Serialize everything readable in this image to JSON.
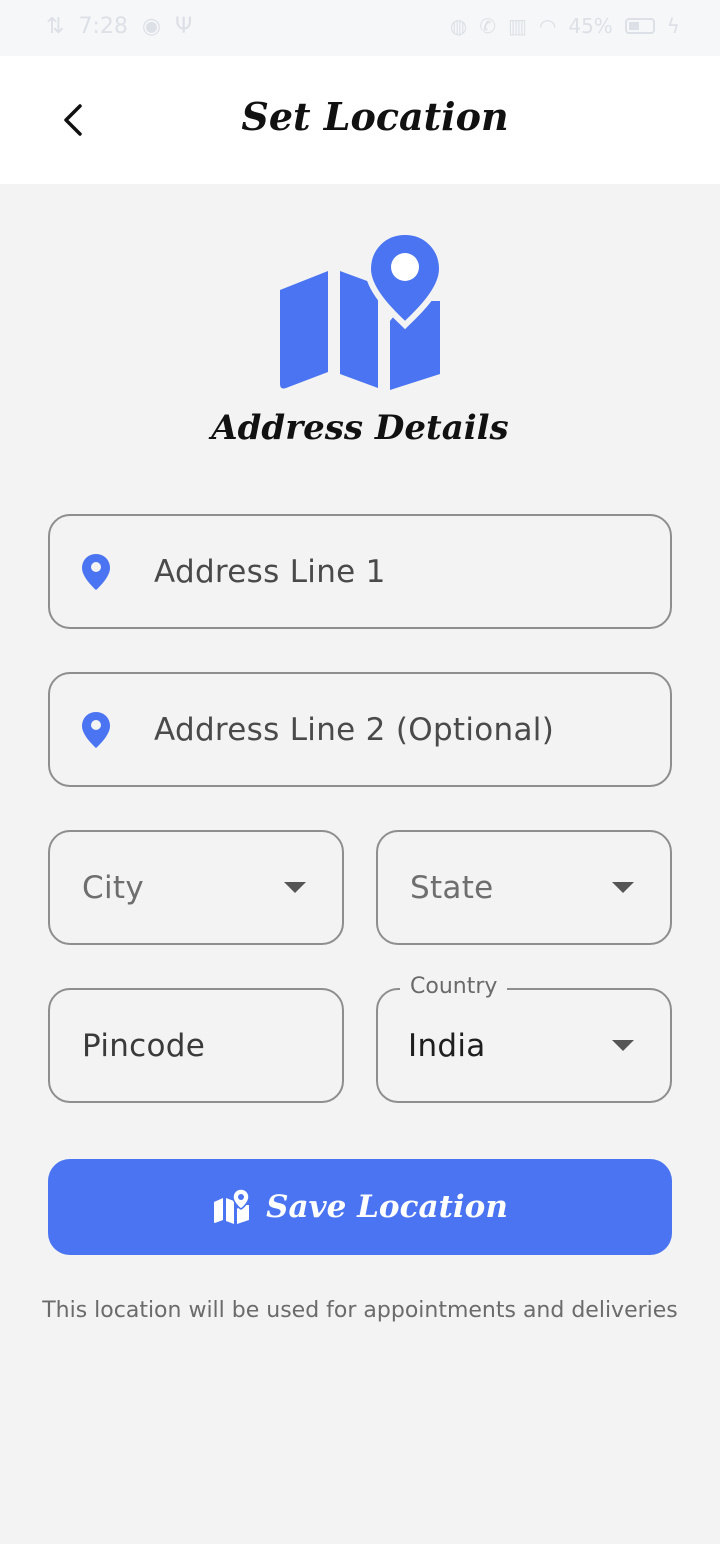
{
  "status_bar": {
    "time": "7:28",
    "battery_percent": "45%"
  },
  "app_bar": {
    "title": "Set Location",
    "back_icon": "chevron-left-icon"
  },
  "hero": {
    "icon": "map-pin-icon",
    "title": "Address Details",
    "accent_color": "#4a74f1"
  },
  "form": {
    "address_line_1": {
      "placeholder": "Address Line 1",
      "value": ""
    },
    "address_line_2": {
      "placeholder": "Address Line 2 (Optional)",
      "value": ""
    },
    "city": {
      "placeholder": "City",
      "value": ""
    },
    "state": {
      "placeholder": "State",
      "value": ""
    },
    "pincode": {
      "placeholder": "Pincode",
      "value": ""
    },
    "country": {
      "label": "Country",
      "value": "India"
    }
  },
  "save_button": {
    "label": "Save Location",
    "icon": "map-pin-icon"
  },
  "helper_text": "This location will be used for appointments and deliveries"
}
